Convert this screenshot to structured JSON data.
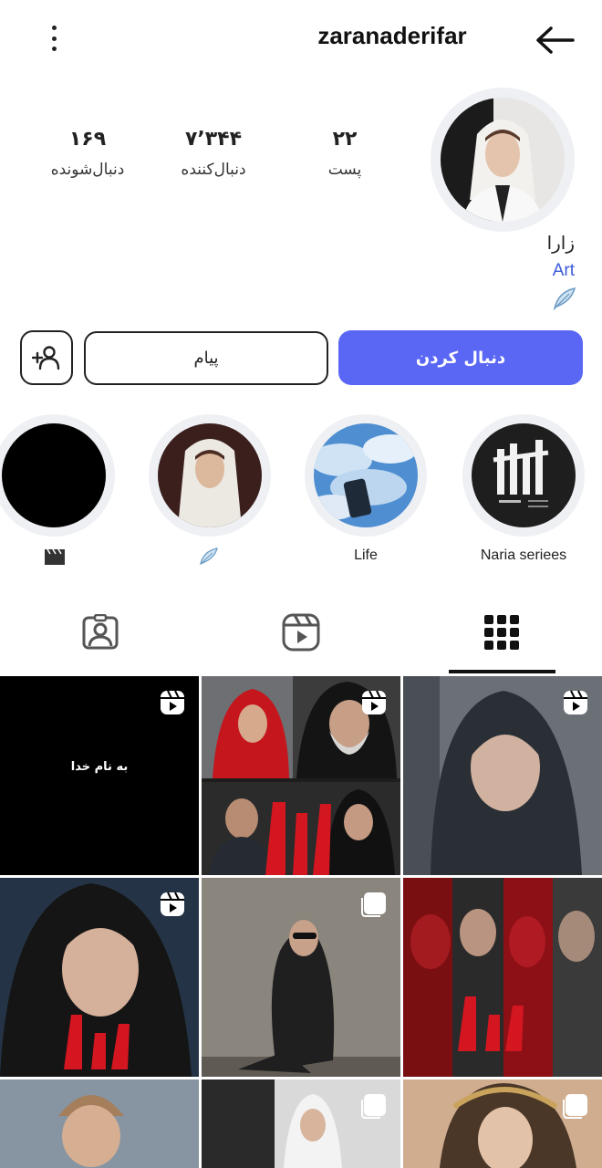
{
  "header": {
    "username": "zaranaderifar",
    "more_icon": "more-vertical-icon",
    "back_icon": "arrow-back-icon"
  },
  "profile": {
    "display_name": "زارا",
    "bio_link": "Art",
    "bio_icon": "feather-icon"
  },
  "stats": {
    "posts": {
      "value": "۲۲",
      "label": "پست"
    },
    "followers": {
      "value": "۷٬۳۴۴",
      "label": "دنبال‌کننده"
    },
    "following": {
      "value": "۱۶۹",
      "label": "دنبال‌شونده"
    }
  },
  "actions": {
    "follow_label": "دنبال کردن",
    "message_label": "پیام",
    "suggest_icon": "add-person-icon",
    "follow_color": "#5a67f5"
  },
  "highlights": [
    {
      "label": "Naria seriees",
      "icon": ""
    },
    {
      "label": "Life",
      "icon": ""
    },
    {
      "label": "",
      "icon": "feather-icon"
    },
    {
      "label": "",
      "icon": "clapperboard-icon"
    }
  ],
  "tabs": [
    {
      "name": "tagged",
      "icon": "tagged-person-icon",
      "active": false
    },
    {
      "name": "reels",
      "icon": "reels-icon",
      "active": false
    },
    {
      "name": "grid",
      "icon": "grid-icon",
      "active": true
    }
  ],
  "grid": {
    "first_post_text": "به نام خدا",
    "posts": [
      {
        "badge": "reel-icon"
      },
      {
        "badge": "reel-icon"
      },
      {
        "badge": "reel-icon"
      },
      {
        "badge": "reel-icon"
      },
      {
        "badge": "carousel-icon"
      },
      {
        "badge": "none"
      },
      {
        "badge": "none"
      },
      {
        "badge": "carousel-icon"
      },
      {
        "badge": "carousel-icon"
      }
    ]
  }
}
